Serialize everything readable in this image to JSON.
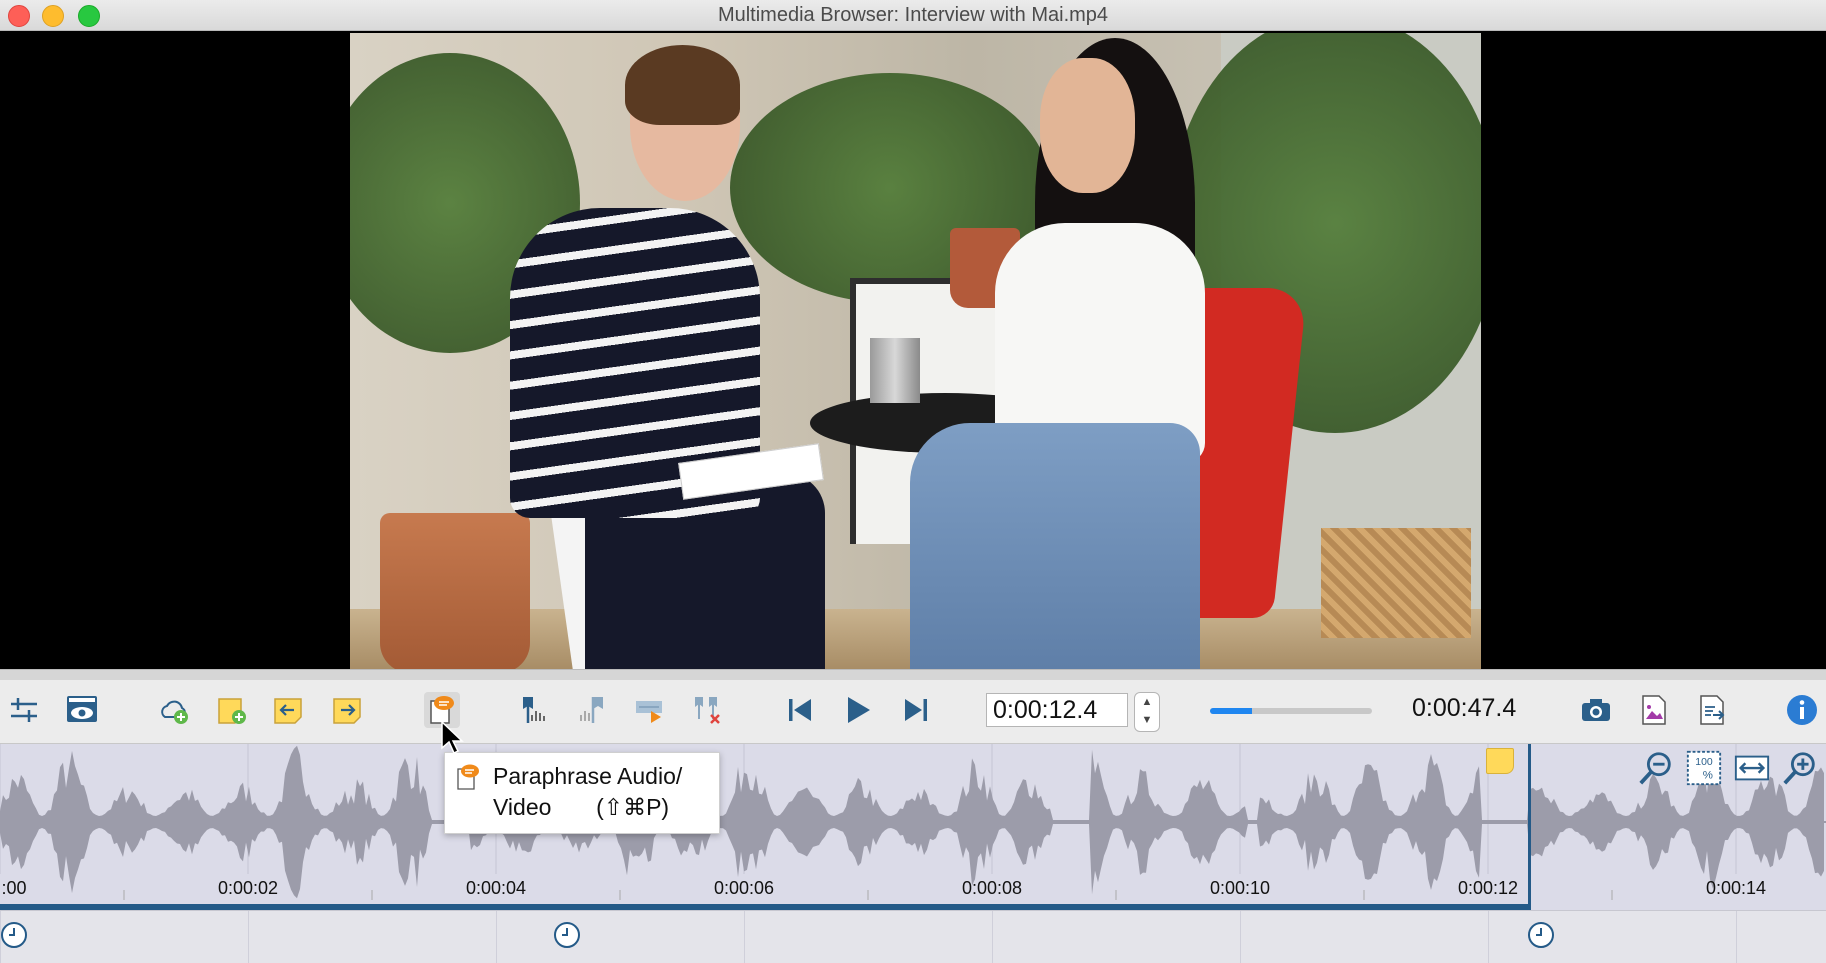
{
  "window": {
    "title": "Multimedia Browser:  Interview with Mai.mp4"
  },
  "colors": {
    "accent": "#1f86f0",
    "playhead": "#245a88",
    "waveform": "#9c9caa",
    "timeline_bg": "#dbdbe8",
    "memo": "#ffd95a"
  },
  "toolbar": {
    "items": [
      {
        "name": "settings-sliders-icon"
      },
      {
        "name": "video-preview-eye-icon"
      },
      {
        "name": "add-cloud-icon"
      },
      {
        "name": "new-memo-icon"
      },
      {
        "name": "previous-memo-icon"
      },
      {
        "name": "next-memo-icon"
      },
      {
        "name": "paraphrase-icon"
      },
      {
        "name": "set-segment-start-icon"
      },
      {
        "name": "set-segment-end-icon"
      },
      {
        "name": "play-segment-icon"
      },
      {
        "name": "delete-segment-icon"
      },
      {
        "name": "skip-back-icon"
      },
      {
        "name": "play-icon"
      },
      {
        "name": "skip-forward-icon"
      },
      {
        "name": "snapshot-camera-icon"
      },
      {
        "name": "export-image-icon"
      },
      {
        "name": "export-document-icon"
      },
      {
        "name": "info-icon"
      }
    ],
    "current_time": "0:00:12.4",
    "duration": "0:00:47.4",
    "progress": 0.26
  },
  "timeline": {
    "ticks": [
      ":00",
      "0:00:02",
      "0:00:04",
      "0:00:06",
      "0:00:08",
      "0:00:10",
      "0:00:12",
      "0:00:14"
    ],
    "playhead_time": 12.4,
    "zoom_controls": [
      {
        "name": "zoom-out-icon"
      },
      {
        "name": "zoom-100-icon",
        "label": "100"
      },
      {
        "name": "fit-width-icon"
      },
      {
        "name": "zoom-in-icon"
      }
    ]
  },
  "tooltip": {
    "text": "Paraphrase Audio/\nVideo       (⇧⌘P)"
  }
}
